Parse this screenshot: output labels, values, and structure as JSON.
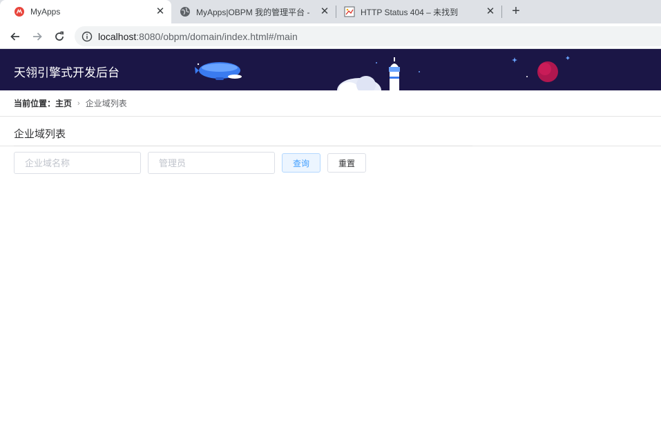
{
  "browser": {
    "tabs": [
      {
        "title": "MyApps",
        "active": true
      },
      {
        "title": "MyApps|OBPM 我的管理平台 -",
        "active": false
      },
      {
        "title": "HTTP Status 404 – 未找到",
        "active": false
      }
    ],
    "url_host": "localhost",
    "url_rest": ":8080/obpm/domain/index.html#/main"
  },
  "header": {
    "title": "天翎引擎式开发后台"
  },
  "breadcrumb": {
    "lead": "当前位置：",
    "home": "主页",
    "current": "企业域列表"
  },
  "page": {
    "title": "企业域列表"
  },
  "filters": {
    "domain_name_placeholder": "企业域名称",
    "admin_placeholder": "管理员",
    "query_label": "查询",
    "reset_label": "重置"
  },
  "colors": {
    "header_bg": "#1b1646",
    "primary": "#409eff"
  }
}
